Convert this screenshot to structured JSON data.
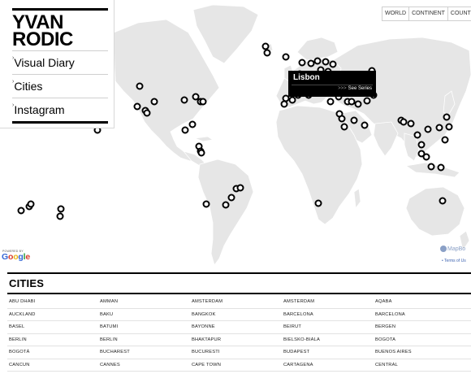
{
  "sidebar": {
    "logo_line1": "YVAN",
    "logo_line2": "RODIC",
    "nav": [
      {
        "label": "Visual Diary"
      },
      {
        "label": "Cities"
      },
      {
        "label": "Instagram"
      }
    ],
    "arrow_glyph": "›"
  },
  "view_switch": [
    "WORLD",
    "CONTINENT",
    "COUNTRY"
  ],
  "popup": {
    "title": "Lisbon",
    "link_chevron": ">>>",
    "link_label": "See Series"
  },
  "credits": {
    "powered_by": "POWERED BY",
    "google": [
      "G",
      "o",
      "o",
      "g",
      "l",
      "e"
    ],
    "mapbox": "MapBo",
    "terms": "• Terms of Us"
  },
  "cities": {
    "heading": "CITIES",
    "rows": [
      [
        "ABU DHABI",
        "AMMAN",
        "AMSTERDAM",
        "AMSTERDAM",
        "AQABA"
      ],
      [
        "AUCKLAND",
        "BAKU",
        "BANGKOK",
        "BARCELONA",
        "BARCELONA"
      ],
      [
        "BASEL",
        "BATUMI",
        "BAYONNE",
        "BEIRUT",
        "BERGEN"
      ],
      [
        "BERLIN",
        "BERLIN",
        "BHAKTAPUR",
        "BIELSKO-BIALA",
        "BOGOTA"
      ],
      [
        "BOGOTÁ",
        "BUCHAREST",
        "BUCURESTI",
        "BUDAPEST",
        "BUENOS AIRES"
      ],
      [
        "CANCUN",
        "CANNES",
        "CAPE TOWN",
        "CARTAGENA",
        "CENTRAL"
      ]
    ]
  },
  "colors": {
    "land": "#e8e8e8",
    "land_border": "#ffffff",
    "marker": "#000000",
    "popup_bg": "#000000"
  }
}
